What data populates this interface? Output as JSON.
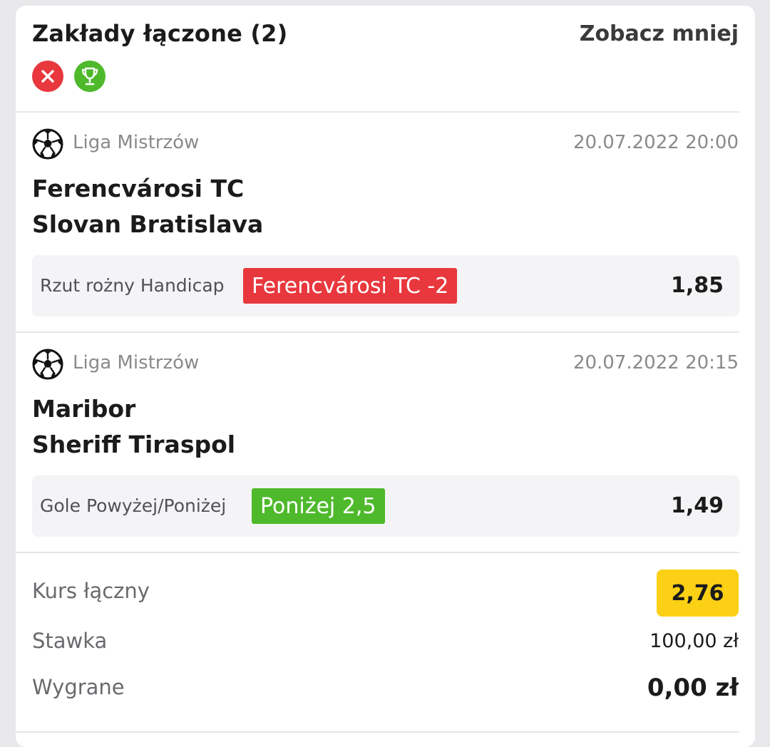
{
  "header": {
    "title": "Zakłady łączone (2)",
    "toggle_label": "Zobacz mniej",
    "status_icons": [
      "close-icon",
      "trophy-icon"
    ]
  },
  "bets": [
    {
      "sport_icon": "soccer-ball-icon",
      "league": "Liga Mistrzów",
      "datetime": "20.07.2022 20:00",
      "team_home": "Ferencvárosi TC",
      "team_away": "Slovan Bratislava",
      "market": "Rzut rożny Handicap",
      "pick": "Ferencvárosi TC -2",
      "pick_status": "lost",
      "odds": "1,85"
    },
    {
      "sport_icon": "soccer-ball-icon",
      "league": "Liga Mistrzów",
      "datetime": "20.07.2022 20:15",
      "team_home": "Maribor",
      "team_away": "Sheriff Tiraspol",
      "market": "Gole Powyżej/Poniżej",
      "pick": "Poniżej 2,5",
      "pick_status": "won",
      "odds": "1,49"
    }
  ],
  "summary": {
    "total_odds_label": "Kurs łączny",
    "total_odds": "2,76",
    "stake_label": "Stawka",
    "stake": "100,00 zł",
    "winnings_label": "Wygrane",
    "winnings": "0,00 zł"
  },
  "colors": {
    "lost": "#e8383d",
    "won": "#4fb92c",
    "total_badge": "#fcd014"
  }
}
